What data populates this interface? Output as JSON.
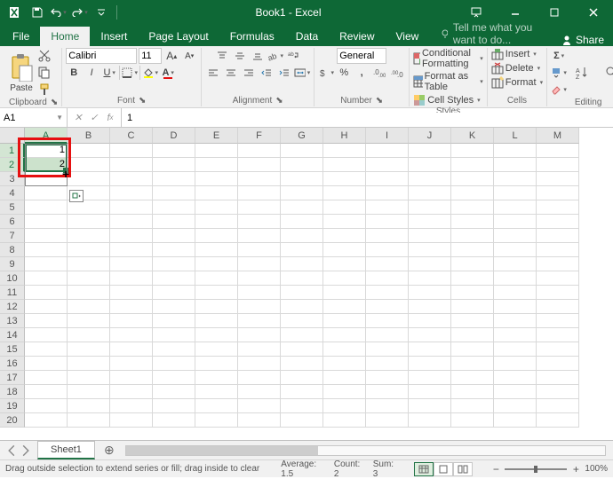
{
  "title": "Book1 - Excel",
  "tabs": {
    "file": "File",
    "home": "Home",
    "insert": "Insert",
    "page_layout": "Page Layout",
    "formulas": "Formulas",
    "data": "Data",
    "review": "Review",
    "view": "View",
    "tell_me": "Tell me what you want to do...",
    "share": "Share"
  },
  "ribbon": {
    "clipboard": {
      "label": "Clipboard",
      "paste": "Paste"
    },
    "font": {
      "label": "Font",
      "name": "Calibri",
      "size": "11",
      "bold": "B",
      "italic": "I",
      "underline": "U"
    },
    "alignment": {
      "label": "Alignment"
    },
    "number": {
      "label": "Number",
      "format": "General"
    },
    "styles": {
      "label": "Styles",
      "cond": "Conditional Formatting",
      "table": "Format as Table",
      "cell": "Cell Styles"
    },
    "cells": {
      "label": "Cells",
      "insert": "Insert",
      "delete": "Delete",
      "format": "Format"
    },
    "editing": {
      "label": "Editing"
    }
  },
  "formula_bar": {
    "name": "A1",
    "value": "1"
  },
  "columns": [
    "A",
    "B",
    "C",
    "D",
    "E",
    "F",
    "G",
    "H",
    "I",
    "J",
    "K",
    "L",
    "M"
  ],
  "rows": 20,
  "cell_data": {
    "A1": "1",
    "A2": "2"
  },
  "selection": {
    "range": "A1:A2",
    "active_cols": [
      "A"
    ],
    "active_rows": [
      1,
      2
    ]
  },
  "sheet": {
    "name": "Sheet1"
  },
  "status": {
    "msg": "Drag outside selection to extend series or fill; drag inside to clear",
    "avg_label": "Average:",
    "avg": "1.5",
    "count_label": "Count:",
    "count": "2",
    "sum_label": "Sum:",
    "sum": "3",
    "zoom": "100%"
  }
}
